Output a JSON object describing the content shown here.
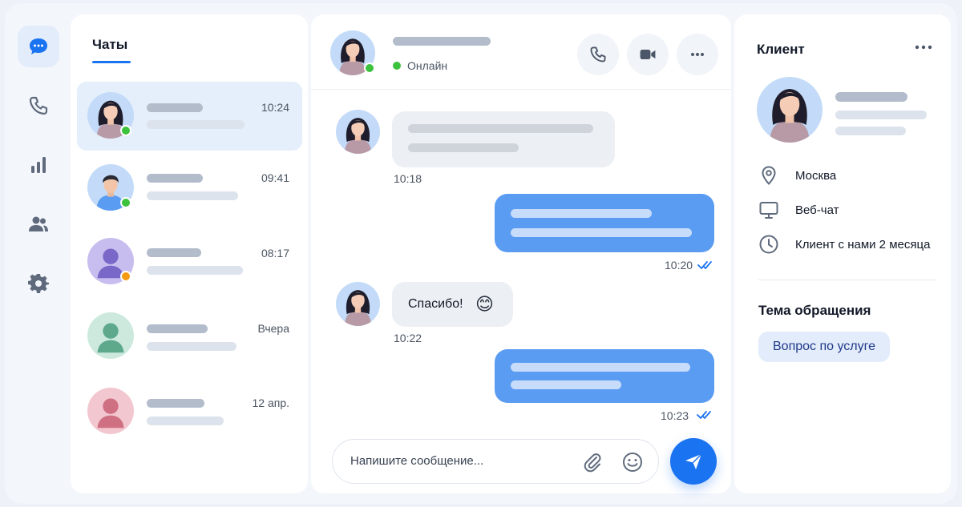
{
  "nav": {
    "items": [
      {
        "icon": "chat-bubble-icon",
        "active": true
      },
      {
        "icon": "phone-icon",
        "active": false
      },
      {
        "icon": "stats-chart-icon",
        "active": false
      },
      {
        "icon": "users-icon",
        "active": false
      },
      {
        "icon": "settings-gear-icon",
        "active": false
      }
    ]
  },
  "chats": {
    "title": "Чаты",
    "items": [
      {
        "time": "10:24",
        "avatar": "woman-avatar",
        "status_color": "#3cc23c",
        "active": true
      },
      {
        "time": "09:41",
        "avatar": "man-avatar",
        "status_color": "#3cc23c",
        "active": false
      },
      {
        "time": "08:17",
        "avatar": "purple-silhouette-avatar",
        "status_color": "#f59a13",
        "active": false
      },
      {
        "time": "Вчера",
        "avatar": "green-silhouette-avatar",
        "status_color": "",
        "active": false
      },
      {
        "time": "12 апр.",
        "avatar": "pink-silhouette-avatar",
        "status_color": "",
        "active": false
      }
    ]
  },
  "conversation": {
    "status": "Онлайн",
    "messages": [
      {
        "direction": "in",
        "time": "10:18"
      },
      {
        "direction": "out",
        "time": "10:20",
        "read": true
      },
      {
        "direction": "in",
        "text": "Спасибо!",
        "emoji": "😊",
        "time": "10:22"
      },
      {
        "direction": "out",
        "time": "10:23",
        "read": true
      }
    ],
    "composer_placeholder": "Напишите сообщение..."
  },
  "client": {
    "title": "Клиент",
    "location": "Москва",
    "channel": "Веб-чат",
    "tenure": "Клиент с нами 2 месяца",
    "topic_title": "Тема обращения",
    "topic": "Вопрос по услуге"
  },
  "colors": {
    "accent": "#1a73f0",
    "outgoing_bubble": "#5b9cf3",
    "online": "#3cc23c",
    "away": "#f59a13"
  }
}
